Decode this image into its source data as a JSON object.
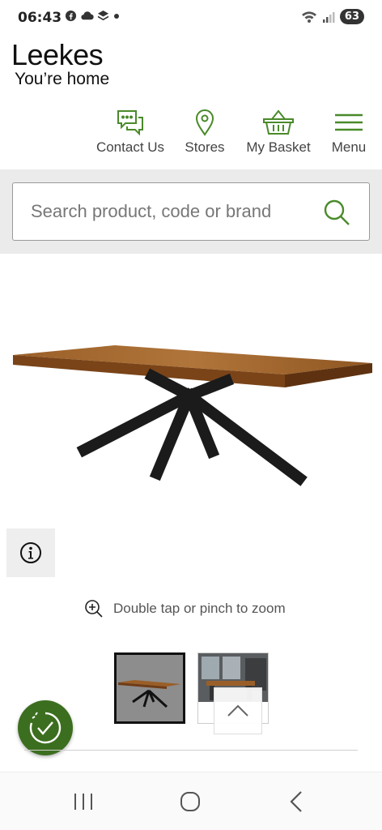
{
  "status_bar": {
    "time": "06:43",
    "battery": "63",
    "icons_left": [
      "facebook-icon",
      "cloud-icon",
      "layers-icon",
      "dot-icon"
    ],
    "icons_right": [
      "wifi-icon",
      "signal-icon",
      "battery-icon"
    ]
  },
  "header": {
    "brand": "Leekes",
    "tagline": "You’re home"
  },
  "nav": {
    "items": [
      {
        "label": "Contact Us",
        "icon": "chat-bubbles-icon"
      },
      {
        "label": "Stores",
        "icon": "location-pin-icon"
      },
      {
        "label": "My Basket",
        "icon": "basket-icon"
      },
      {
        "label": "Menu",
        "icon": "hamburger-icon"
      }
    ]
  },
  "search": {
    "placeholder": "Search product, code or brand"
  },
  "gallery": {
    "zoom_hint": "Double tap or pinch to zoom",
    "thumbnail_count": 2,
    "selected_index": 0
  },
  "colors": {
    "accent_green": "#4a8a2a",
    "accessibility_green": "#3c6e1f",
    "search_band": "#ebebeb"
  }
}
